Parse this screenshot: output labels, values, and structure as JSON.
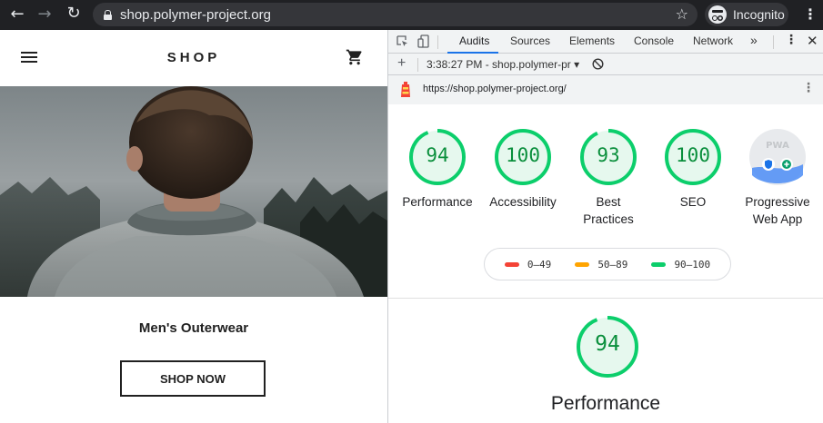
{
  "browser": {
    "url": "shop.polymer-project.org",
    "incognito_label": "Incognito",
    "icons": [
      "back-icon",
      "forward-icon",
      "reload-icon",
      "lock-icon",
      "star-icon",
      "incognito-icon",
      "kebab-icon"
    ]
  },
  "shop": {
    "title": "SHOP",
    "category": "Men's Outerwear",
    "cta": "SHOP NOW"
  },
  "devtools": {
    "tabs": [
      "Audits",
      "Sources",
      "Elements",
      "Console",
      "Network",
      "»"
    ],
    "active_tab": "Audits",
    "report_selector": "3:38:27 PM - shop.polymer-pr ▾",
    "report_url": "https://shop.polymer-project.org/"
  },
  "audits": {
    "categories": [
      {
        "label": "Performance",
        "score": "94",
        "value": 94
      },
      {
        "label": "Accessibility",
        "score": "100",
        "value": 100
      },
      {
        "label": "Best Practices",
        "label_lines": [
          "Best",
          "Practices"
        ],
        "score": "93",
        "value": 93
      },
      {
        "label": "SEO",
        "score": "100",
        "value": 100
      },
      {
        "label": "Progressive Web App",
        "label_lines": [
          "Progressive",
          "Web App"
        ],
        "badge": "PWA"
      }
    ],
    "legend": [
      {
        "range": "0–49",
        "color": "#f44336"
      },
      {
        "range": "50–89",
        "color": "#ffa400"
      },
      {
        "range": "90–100",
        "color": "#0cce6b"
      }
    ],
    "section": {
      "title": "Performance",
      "score": "94",
      "value": 94
    }
  },
  "colors": {
    "pass": "#0cce6b",
    "pass_text": "#0a8f3c",
    "pass_bg": "#e6f8ee",
    "chrome": "#202124",
    "accent": "#1a73e8"
  }
}
